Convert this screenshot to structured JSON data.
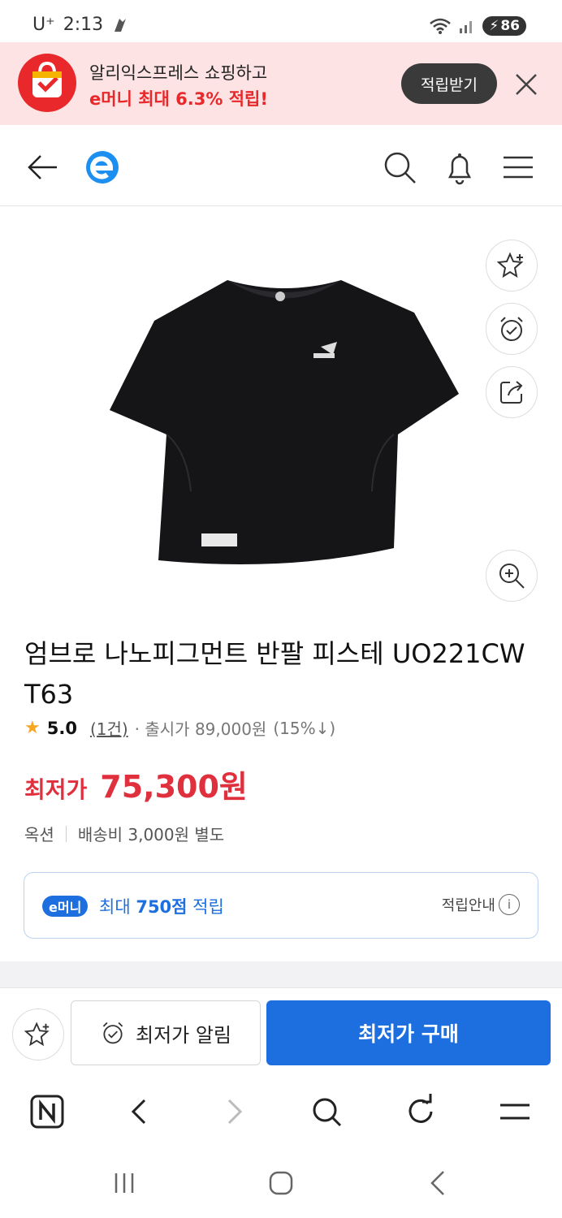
{
  "status_bar": {
    "carrier": "U⁺",
    "time": "2:13",
    "battery": "86"
  },
  "promo": {
    "line1": "알리익스프레스 쇼핑하고",
    "line2": "e머니 최대 6.3% 적립!",
    "button": "적립받기"
  },
  "header": {
    "logo": "e"
  },
  "product": {
    "title": "엄브로 나노피그먼트 반팔 피스테 UO221CW T63",
    "rating": "5.0",
    "review_count": "(1건)",
    "original_price": "· 출시가 89,000원",
    "discount": "(15%↓)",
    "price_label": "최저가",
    "price": "75,300원",
    "option_label": "옥션",
    "shipping": "배송비 3,000원 별도"
  },
  "reward": {
    "badge": "e머니",
    "text_prefix": "최대 ",
    "points": "750점",
    "text_suffix": " 적립",
    "guide": "적립안내"
  },
  "action_bar": {
    "alert_label": "최저가 알림",
    "buy_label": "최저가 구매"
  },
  "colors": {
    "accent": "#1d6fe0",
    "price": "#e0303e",
    "promo_bg": "#fde3e3"
  }
}
